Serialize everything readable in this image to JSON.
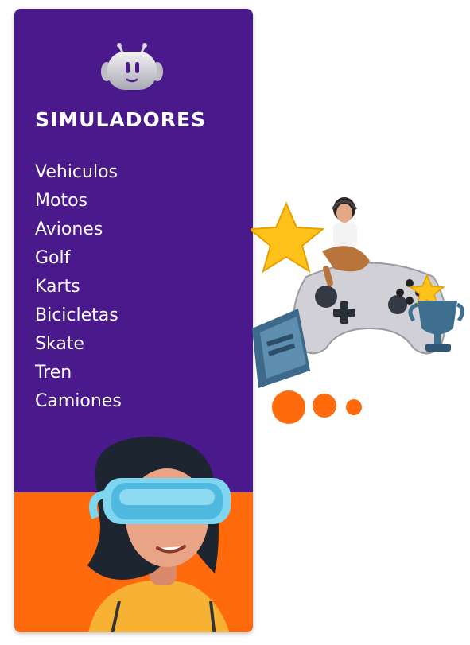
{
  "panel": {
    "title": "SIMULADORES",
    "items": [
      {
        "label": "Vehiculos"
      },
      {
        "label": "Motos"
      },
      {
        "label": "Aviones"
      },
      {
        "label": "Golf"
      },
      {
        "label": "Karts"
      },
      {
        "label": "Bicicletas"
      },
      {
        "label": "Skate"
      },
      {
        "label": "Tren"
      },
      {
        "label": "Camiones"
      }
    ]
  },
  "colors": {
    "panel_purple": "#4a1a8c",
    "accent_orange": "#ff6a0d",
    "star_yellow": "#ffc21a"
  },
  "icons": {
    "logo": "robot-head-icon",
    "illustration_top": "gamer-controller-star-trophy-illustration",
    "illustration_bottom": "vr-headset-girl-illustration"
  }
}
